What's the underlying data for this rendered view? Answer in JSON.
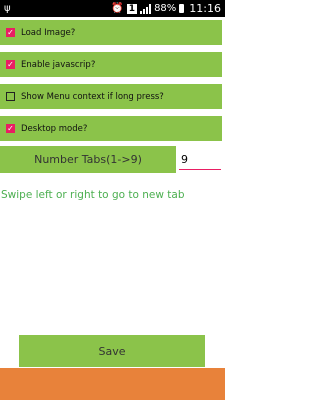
{
  "statusbar": {
    "left_icon": "usb-icon",
    "sim_badge": "1",
    "battery": "88%",
    "time": "11:16"
  },
  "options": [
    {
      "label": "Load Image?",
      "checked": true
    },
    {
      "label": "Enable javascrip?",
      "checked": true
    },
    {
      "label": "Show Menu context if long press?",
      "checked": false
    },
    {
      "label": "Desktop mode?",
      "checked": true
    }
  ],
  "tabs": {
    "label": "Number Tabs(1->9)",
    "value": "9"
  },
  "hint": "Swipe left or right to go to new tab",
  "save_label": "Save",
  "colors": {
    "accent_green": "#8bc34a",
    "hint_green": "#4caf50",
    "checkbox_pink": "#e91e63",
    "bottom_orange": "#e8823a"
  }
}
